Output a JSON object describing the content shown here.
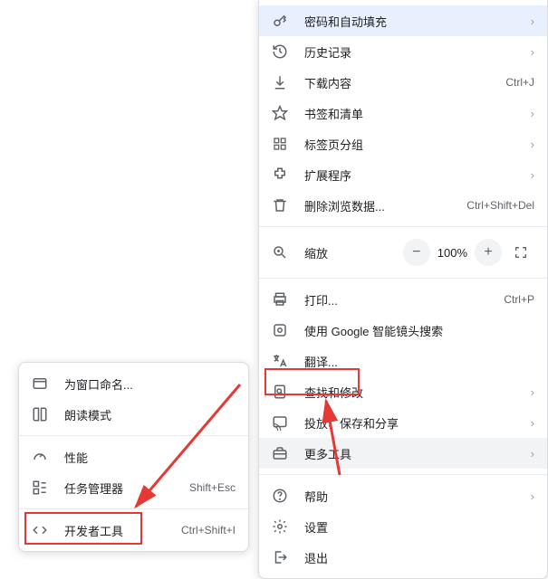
{
  "main_menu": {
    "passwords": {
      "label": "密码和自动填充"
    },
    "history": {
      "label": "历史记录"
    },
    "downloads": {
      "label": "下载内容",
      "shortcut": "Ctrl+J"
    },
    "bookmarks": {
      "label": "书签和清单"
    },
    "tabgroups": {
      "label": "标签页分组"
    },
    "extensions": {
      "label": "扩展程序"
    },
    "clear": {
      "label": "删除浏览数据...",
      "shortcut": "Ctrl+Shift+Del"
    },
    "zoom": {
      "label": "缩放",
      "percent": "100%"
    },
    "print": {
      "label": "打印...",
      "shortcut": "Ctrl+P"
    },
    "lens": {
      "label": "使用 Google 智能镜头搜索"
    },
    "translate": {
      "label": "翻译..."
    },
    "find": {
      "label": "查找和修改"
    },
    "cast": {
      "label": "投放、保存和分享"
    },
    "more": {
      "label": "更多工具"
    },
    "help": {
      "label": "帮助"
    },
    "settings": {
      "label": "设置"
    },
    "exit": {
      "label": "退出"
    }
  },
  "sub_menu": {
    "name_window": {
      "label": "为窗口命名..."
    },
    "reader": {
      "label": "朗读模式"
    },
    "performance": {
      "label": "性能"
    },
    "task_mgr": {
      "label": "任务管理器",
      "shortcut": "Shift+Esc"
    },
    "devtools": {
      "label": "开发者工具",
      "shortcut": "Ctrl+Shift+I"
    }
  }
}
